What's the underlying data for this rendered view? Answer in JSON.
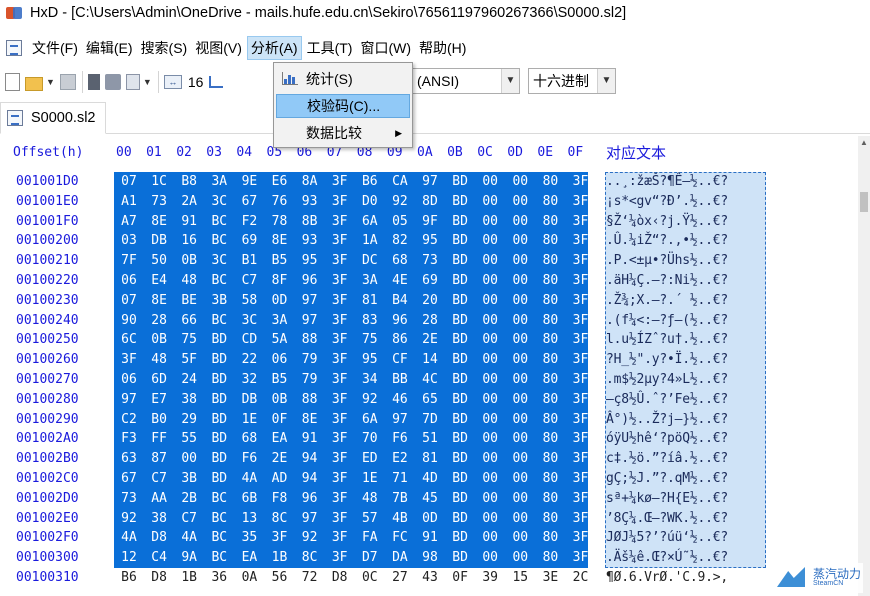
{
  "window": {
    "title": "HxD - [C:\\Users\\Admin\\OneDrive - mails.hufe.edu.cn\\Sekiro\\76561197960267366\\S0000.sl2]"
  },
  "menubar": {
    "items": [
      {
        "label": "文件(F)",
        "name": "menu-file",
        "active": false
      },
      {
        "label": "编辑(E)",
        "name": "menu-edit",
        "active": false
      },
      {
        "label": "搜索(S)",
        "name": "menu-search",
        "active": false
      },
      {
        "label": "视图(V)",
        "name": "menu-view",
        "active": false
      },
      {
        "label": "分析(A)",
        "name": "menu-analysis",
        "active": true
      },
      {
        "label": "工具(T)",
        "name": "menu-tools",
        "active": false
      },
      {
        "label": "窗口(W)",
        "name": "menu-window",
        "active": false
      },
      {
        "label": "帮助(H)",
        "name": "menu-help",
        "active": false
      }
    ]
  },
  "toolbar": {
    "bytes_per_row": "16",
    "encoding": "(ANSI)",
    "offset_base": "十六进制"
  },
  "analysis_menu": {
    "items": [
      {
        "label": "统计(S)",
        "highlighted": false,
        "submenu": false
      },
      {
        "label": "校验码(C)...",
        "highlighted": true,
        "submenu": false
      },
      {
        "label": "数据比较",
        "highlighted": false,
        "submenu": true
      }
    ]
  },
  "tab": {
    "label": "S0000.sl2"
  },
  "hexview": {
    "offset_header": "Offset(h)",
    "column_headers": [
      "00",
      "01",
      "02",
      "03",
      "04",
      "05",
      "06",
      "07",
      "08",
      "09",
      "0A",
      "0B",
      "0C",
      "0D",
      "0E",
      "0F"
    ],
    "text_header": "对应文本",
    "rows": [
      {
        "offset": "001001D0",
        "bytes": [
          "07",
          "1C",
          "B8",
          "3A",
          "9E",
          "E6",
          "8A",
          "3F",
          "B6",
          "CA",
          "97",
          "BD",
          "00",
          "00",
          "80",
          "3F"
        ],
        "text": "..¸:žæŠ?¶Ê—½..€?",
        "selected": true
      },
      {
        "offset": "001001E0",
        "bytes": [
          "A1",
          "73",
          "2A",
          "3C",
          "67",
          "76",
          "93",
          "3F",
          "D0",
          "92",
          "8D",
          "BD",
          "00",
          "00",
          "80",
          "3F"
        ],
        "text": "¡s*<gv“?Ð’.½..€?",
        "selected": true
      },
      {
        "offset": "001001F0",
        "bytes": [
          "A7",
          "8E",
          "91",
          "BC",
          "F2",
          "78",
          "8B",
          "3F",
          "6A",
          "05",
          "9F",
          "BD",
          "00",
          "00",
          "80",
          "3F"
        ],
        "text": "§Ž‘¼òx‹?j.Ÿ½..€?",
        "selected": true
      },
      {
        "offset": "00100200",
        "bytes": [
          "03",
          "DB",
          "16",
          "BC",
          "69",
          "8E",
          "93",
          "3F",
          "1A",
          "82",
          "95",
          "BD",
          "00",
          "00",
          "80",
          "3F"
        ],
        "text": ".Û.¼iŽ“?.‚•½..€?",
        "selected": true
      },
      {
        "offset": "00100210",
        "bytes": [
          "7F",
          "50",
          "0B",
          "3C",
          "B1",
          "B5",
          "95",
          "3F",
          "DC",
          "68",
          "73",
          "BD",
          "00",
          "00",
          "80",
          "3F"
        ],
        "text": ".P.<±µ•?Ühs½..€?",
        "selected": true
      },
      {
        "offset": "00100220",
        "bytes": [
          "06",
          "E4",
          "48",
          "BC",
          "C7",
          "8F",
          "96",
          "3F",
          "3A",
          "4E",
          "69",
          "BD",
          "00",
          "00",
          "80",
          "3F"
        ],
        "text": ".äH¼Ç.–?:Ni½..€?",
        "selected": true
      },
      {
        "offset": "00100230",
        "bytes": [
          "07",
          "8E",
          "BE",
          "3B",
          "58",
          "0D",
          "97",
          "3F",
          "81",
          "B4",
          "20",
          "BD",
          "00",
          "00",
          "80",
          "3F"
        ],
        "text": ".Ž¾;X.—?.´ ½..€?",
        "selected": true
      },
      {
        "offset": "00100240",
        "bytes": [
          "90",
          "28",
          "66",
          "BC",
          "3C",
          "3A",
          "97",
          "3F",
          "83",
          "96",
          "28",
          "BD",
          "00",
          "00",
          "80",
          "3F"
        ],
        "text": ".(f¼<:—?ƒ–(½..€?",
        "selected": true
      },
      {
        "offset": "00100250",
        "bytes": [
          "6C",
          "0B",
          "75",
          "BD",
          "CD",
          "5A",
          "88",
          "3F",
          "75",
          "86",
          "2E",
          "BD",
          "00",
          "00",
          "80",
          "3F"
        ],
        "text": "l.u½ÍZˆ?u†.½..€?",
        "selected": true
      },
      {
        "offset": "00100260",
        "bytes": [
          "3F",
          "48",
          "5F",
          "BD",
          "22",
          "06",
          "79",
          "3F",
          "95",
          "CF",
          "14",
          "BD",
          "00",
          "00",
          "80",
          "3F"
        ],
        "text": "?H_½\".y?•Ï.½..€?",
        "selected": true
      },
      {
        "offset": "00100270",
        "bytes": [
          "06",
          "6D",
          "24",
          "BD",
          "32",
          "B5",
          "79",
          "3F",
          "34",
          "BB",
          "4C",
          "BD",
          "00",
          "00",
          "80",
          "3F"
        ],
        "text": ".m$½2µy?4»L½..€?",
        "selected": true
      },
      {
        "offset": "00100280",
        "bytes": [
          "97",
          "E7",
          "38",
          "BD",
          "DB",
          "0B",
          "88",
          "3F",
          "92",
          "46",
          "65",
          "BD",
          "00",
          "00",
          "80",
          "3F"
        ],
        "text": "—ç8½Û.ˆ?’Fe½..€?",
        "selected": true
      },
      {
        "offset": "00100290",
        "bytes": [
          "C2",
          "B0",
          "29",
          "BD",
          "1E",
          "0F",
          "8E",
          "3F",
          "6A",
          "97",
          "7D",
          "BD",
          "00",
          "00",
          "80",
          "3F"
        ],
        "text": "Â°)½..Ž?j—}½..€?",
        "selected": true
      },
      {
        "offset": "001002A0",
        "bytes": [
          "F3",
          "FF",
          "55",
          "BD",
          "68",
          "EA",
          "91",
          "3F",
          "70",
          "F6",
          "51",
          "BD",
          "00",
          "00",
          "80",
          "3F"
        ],
        "text": "óÿU½hê‘?pöQ½..€?",
        "selected": true
      },
      {
        "offset": "001002B0",
        "bytes": [
          "63",
          "87",
          "00",
          "BD",
          "F6",
          "2E",
          "94",
          "3F",
          "ED",
          "E2",
          "81",
          "BD",
          "00",
          "00",
          "80",
          "3F"
        ],
        "text": "c‡.½ö.”?íâ.½..€?",
        "selected": true
      },
      {
        "offset": "001002C0",
        "bytes": [
          "67",
          "C7",
          "3B",
          "BD",
          "4A",
          "AD",
          "94",
          "3F",
          "1E",
          "71",
          "4D",
          "BD",
          "00",
          "00",
          "80",
          "3F"
        ],
        "text": "gÇ;½J.”?.qM½..€?",
        "selected": true
      },
      {
        "offset": "001002D0",
        "bytes": [
          "73",
          "AA",
          "2B",
          "BC",
          "6B",
          "F8",
          "96",
          "3F",
          "48",
          "7B",
          "45",
          "BD",
          "00",
          "00",
          "80",
          "3F"
        ],
        "text": "sª+¼kø–?H{E½..€?",
        "selected": true
      },
      {
        "offset": "001002E0",
        "bytes": [
          "92",
          "38",
          "C7",
          "BC",
          "13",
          "8C",
          "97",
          "3F",
          "57",
          "4B",
          "0D",
          "BD",
          "00",
          "00",
          "80",
          "3F"
        ],
        "text": "’8Ç¼.Œ—?WK.½..€?",
        "selected": true
      },
      {
        "offset": "001002F0",
        "bytes": [
          "4A",
          "D8",
          "4A",
          "BC",
          "35",
          "3F",
          "92",
          "3F",
          "FA",
          "FC",
          "91",
          "BD",
          "00",
          "00",
          "80",
          "3F"
        ],
        "text": "JØJ¼5?’?úü‘½..€?",
        "selected": true
      },
      {
        "offset": "00100300",
        "bytes": [
          "12",
          "C4",
          "9A",
          "BC",
          "EA",
          "1B",
          "8C",
          "3F",
          "D7",
          "DA",
          "98",
          "BD",
          "00",
          "00",
          "80",
          "3F"
        ],
        "text": ".Äš¼ê.Œ?×Ú˜½..€?",
        "selected": true
      },
      {
        "offset": "00100310",
        "bytes": [
          "B6",
          "D8",
          "1B",
          "36",
          "0A",
          "56",
          "72",
          "D8",
          "0C",
          "27",
          "43",
          "0F",
          "39",
          "15",
          "3E",
          "2C"
        ],
        "text": "¶Ø.6.VrØ.'C.9.>,",
        "selected": false
      }
    ]
  },
  "watermark": {
    "text": "蒸汽动力",
    "sub": "SteamCN"
  },
  "colors": {
    "selection_hex": "#0a6fd8",
    "selection_text": "#cfe3f7",
    "offset_blue": "#1a1adc",
    "menu_active": "#cce4f7",
    "menu_highlight": "#91c9f7"
  }
}
